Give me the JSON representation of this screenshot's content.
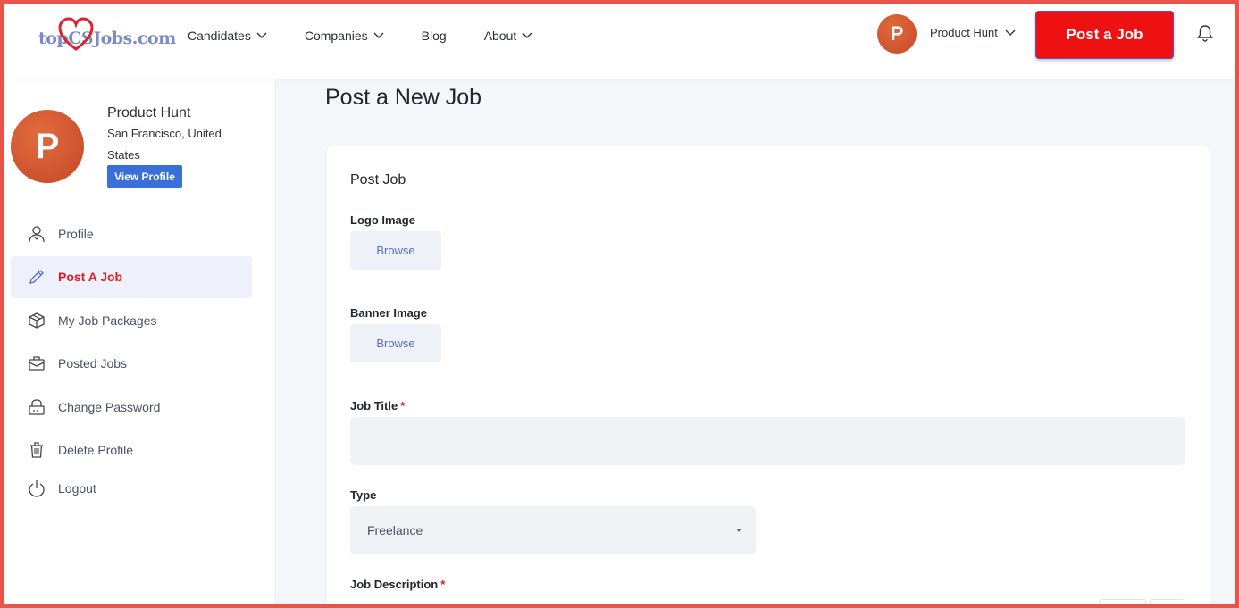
{
  "brand": {
    "logo_text": "topCSJobs.com",
    "accent": "#ee1111",
    "logo_color": "#7b8bc4"
  },
  "nav": {
    "items": [
      {
        "label": "Candidates",
        "has_dropdown": true
      },
      {
        "label": "Companies",
        "has_dropdown": true
      },
      {
        "label": "Blog",
        "has_dropdown": false
      },
      {
        "label": "About",
        "has_dropdown": true
      }
    ]
  },
  "account": {
    "avatar_letter": "P",
    "name": "Product Hunt"
  },
  "header": {
    "post_job_label": "Post a Job"
  },
  "profile": {
    "avatar_letter": "P",
    "name": "Product Hunt",
    "location": "San Francisco, United States",
    "view_profile_label": "View Profile"
  },
  "sidebar": {
    "items": [
      {
        "label": "Profile",
        "icon": "user-icon",
        "active": false
      },
      {
        "label": "Post A Job",
        "icon": "pencil-icon",
        "active": true
      },
      {
        "label": "My Job Packages",
        "icon": "package-icon",
        "active": false
      },
      {
        "label": "Posted Jobs",
        "icon": "briefcase-icon",
        "active": false
      },
      {
        "label": "Change Password",
        "icon": "lock-icon",
        "active": false
      },
      {
        "label": "Delete Profile",
        "icon": "trash-icon",
        "active": false
      },
      {
        "label": "Logout",
        "icon": "power-icon",
        "active": false
      }
    ]
  },
  "main": {
    "page_title": "Post a New Job",
    "card_title": "Post Job",
    "logo_image": {
      "label": "Logo Image",
      "button": "Browse"
    },
    "banner_image": {
      "label": "Banner Image",
      "button": "Browse"
    },
    "job_title": {
      "label": "Job Title",
      "required": "*",
      "value": ""
    },
    "type": {
      "label": "Type",
      "selected": "Freelance"
    },
    "job_description": {
      "label": "Job Description",
      "required": "*"
    }
  }
}
